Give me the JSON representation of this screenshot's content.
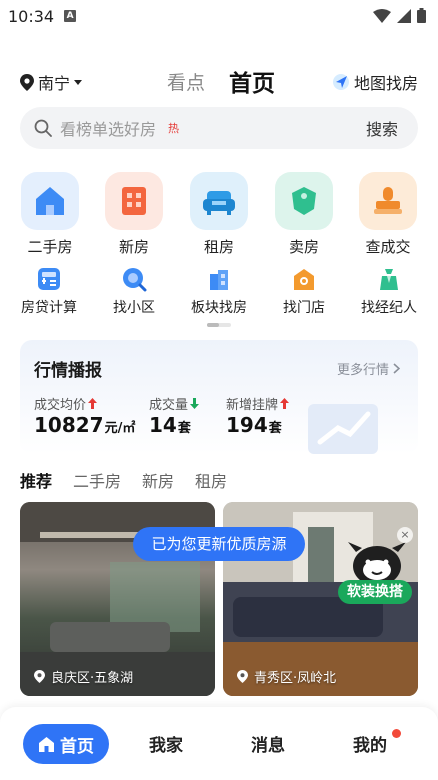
{
  "status_bar": {
    "time": "10:34",
    "notification_letter": "A"
  },
  "top_nav": {
    "city": "南宁",
    "tab_kandian": "看点",
    "tab_home": "首页",
    "map_find": "地图找房"
  },
  "search": {
    "placeholder": "看榜单选好房",
    "hot_tag": "热",
    "button": "搜索"
  },
  "main_categories": [
    {
      "label": "二手房",
      "icon": "house-icon",
      "color": "#3d8bf5"
    },
    {
      "label": "新房",
      "icon": "building-icon",
      "color": "#f3663f"
    },
    {
      "label": "租房",
      "icon": "sofa-icon",
      "color": "#2e9be6"
    },
    {
      "label": "卖房",
      "icon": "tag-icon",
      "color": "#2fbf8f"
    },
    {
      "label": "查成交",
      "icon": "stamp-icon",
      "color": "#f08a2c"
    }
  ],
  "sub_categories": [
    {
      "label": "房贷计算",
      "icon": "calculator-icon"
    },
    {
      "label": "找小区",
      "icon": "search-community-icon"
    },
    {
      "label": "板块找房",
      "icon": "block-icon"
    },
    {
      "label": "找门店",
      "icon": "store-icon"
    },
    {
      "label": "找经纪人",
      "icon": "agent-icon"
    }
  ],
  "market": {
    "title": "行情播报",
    "more": "更多行情",
    "stats": [
      {
        "label": "成交均价",
        "value": "10827",
        "unit": "元/㎡",
        "trend": "up"
      },
      {
        "label": "成交量",
        "value": "14",
        "unit": "套",
        "trend": "down"
      },
      {
        "label": "新增挂牌",
        "value": "194",
        "unit": "套",
        "trend": "up"
      }
    ]
  },
  "recommend_tabs": [
    {
      "label": "推荐",
      "active": true
    },
    {
      "label": "二手房",
      "active": false
    },
    {
      "label": "新房",
      "active": false
    },
    {
      "label": "租房",
      "active": false
    }
  ],
  "listings": [
    {
      "location": "良庆区·五象湖"
    },
    {
      "location": "青秀区·凤岭北"
    }
  ],
  "toast": "已为您更新优质房源",
  "promo": {
    "label": "软装换搭",
    "close": "×"
  },
  "bottom_nav": {
    "home": "首页",
    "items": [
      "我家",
      "消息",
      "我的"
    ]
  },
  "colors": {
    "accent": "#2f74f6",
    "hot": "#e53935",
    "up": "#e53935",
    "down": "#1aa85b",
    "promo": "#1aa85b"
  }
}
